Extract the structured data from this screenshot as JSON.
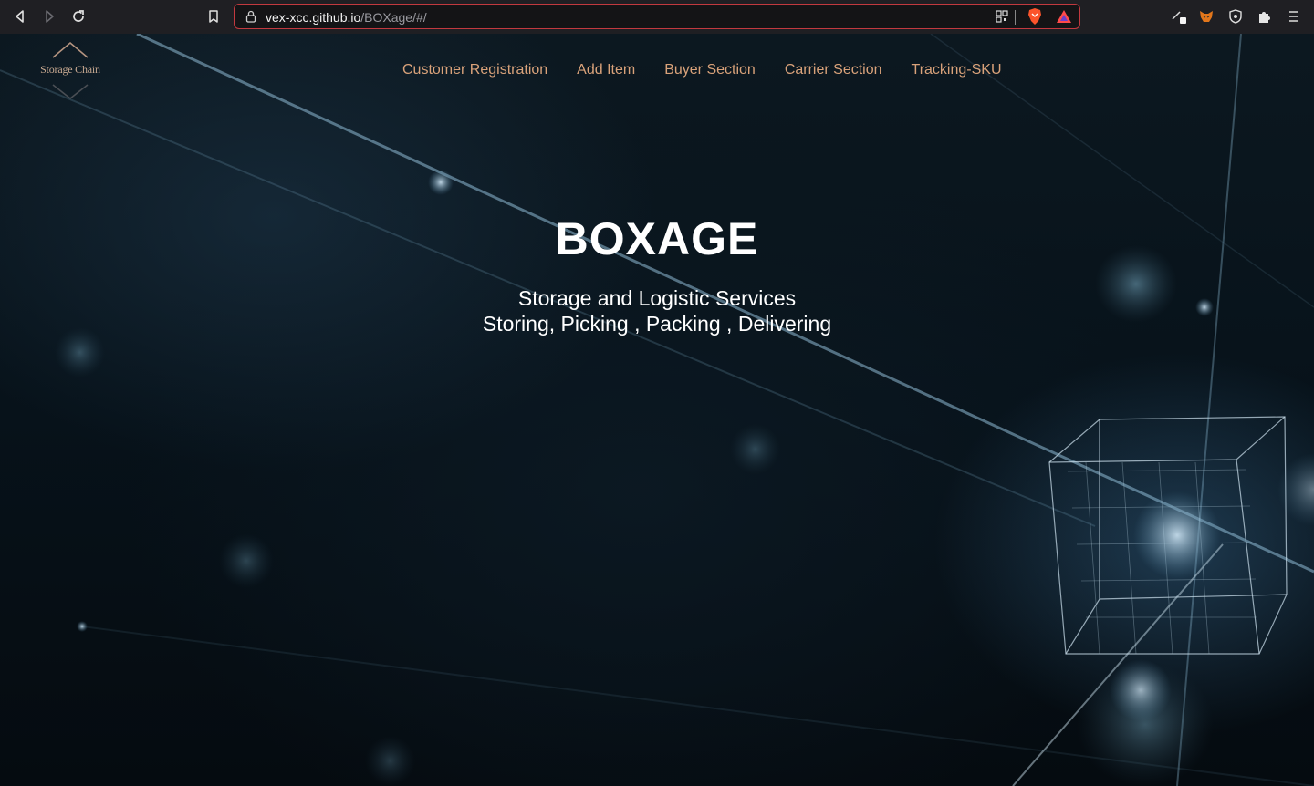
{
  "browser": {
    "url_host": "vex-xcc.github.io",
    "url_path": "/BOXage/#/",
    "icons": [
      "back-icon",
      "forward-icon",
      "reload-icon",
      "bookmark-icon",
      "lock-icon",
      "qr-code-icon",
      "brave-shields-icon",
      "brave-rewards-icon",
      "extension-pen-icon",
      "metamask-icon",
      "shield-extension-icon",
      "puzzle-icon",
      "menu-icon"
    ],
    "accent_color": "#c2393f"
  },
  "header": {
    "logo_text": "Storage Chain",
    "nav": [
      {
        "label": "Customer Registration"
      },
      {
        "label": "Add Item"
      },
      {
        "label": "Buyer Section"
      },
      {
        "label": "Carrier Section"
      },
      {
        "label": "Tracking-SKU"
      }
    ],
    "nav_color": "#d9a27a"
  },
  "hero": {
    "title": "BOXAGE",
    "subtitle_line1": "Storage and Logistic Services",
    "subtitle_line2": "Storing, Picking , Packing , Delivering"
  }
}
